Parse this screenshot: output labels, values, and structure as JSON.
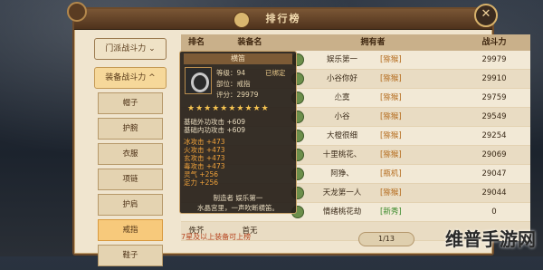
{
  "window": {
    "title": "排行榜",
    "close_icon": "diamond-close-icon"
  },
  "sidebar": {
    "category1": "门派战斗力 ⌄",
    "category2": "装备战斗力 ^",
    "items": [
      "帽子",
      "护腕",
      "衣服",
      "项链",
      "护肩",
      "戒指",
      "鞋子"
    ],
    "selected_index": 5
  },
  "table": {
    "headers": [
      "排名",
      "装备名",
      "拥有者",
      "战斗力"
    ],
    "rows": [
      {
        "rank": "",
        "equip": "",
        "owner": "娱乐第一",
        "guild": "[猕猴]",
        "power": "29979"
      },
      {
        "rank": "",
        "equip": "",
        "owner": "小谷你好",
        "guild": "[猕猴]",
        "power": "29910"
      },
      {
        "rank": "",
        "equip": "",
        "owner": "尐寞",
        "guild": "[猕猴]",
        "power": "29759"
      },
      {
        "rank": "",
        "equip": "",
        "owner": "小谷",
        "guild": "[猕猴]",
        "power": "29549"
      },
      {
        "rank": "",
        "equip": "",
        "owner": "大橙很细",
        "guild": "[猕猴]",
        "power": "29254"
      },
      {
        "rank": "",
        "equip": "",
        "owner": "十里桃花、",
        "guild": "[猕猴]",
        "power": "29069"
      },
      {
        "rank": "",
        "equip": "",
        "owner": "阿狰、",
        "guild": "[瓶机]",
        "power": "29047"
      },
      {
        "rank": "",
        "equip": "",
        "owner": "天龙第一人",
        "guild": "[猕猴]",
        "power": "29044"
      },
      {
        "rank": "",
        "equip": "",
        "owner": "情绪桃花劫",
        "guild": "[新秀]",
        "power": "0"
      },
      {
        "rank": "",
        "equip": "",
        "owner": "",
        "guild": "",
        "power": ""
      }
    ],
    "footer_note": "7星及以上装备可上榜",
    "page": "1/13",
    "last_row_rank": "佚芥",
    "last_row_equip": "首无"
  },
  "tooltip": {
    "title": "横笛",
    "level_label": "等级：94",
    "bound": "已绑定",
    "slot": "部位：戒指",
    "score": "评分：29979",
    "stars": "★★★★★★★★★★",
    "base_external": "基础外功攻击 +609",
    "base_internal": "基础内功攻击 +609",
    "attrs": [
      "冰攻击 +473",
      "火攻击 +473",
      "玄攻击 +473",
      "毒攻击 +473",
      "灵气 +256",
      "定力 +256"
    ],
    "maker": "制造者  娱乐第一",
    "desc": "水晶宫里，一声吹断横笛。"
  },
  "watermark": "维普手游网"
}
